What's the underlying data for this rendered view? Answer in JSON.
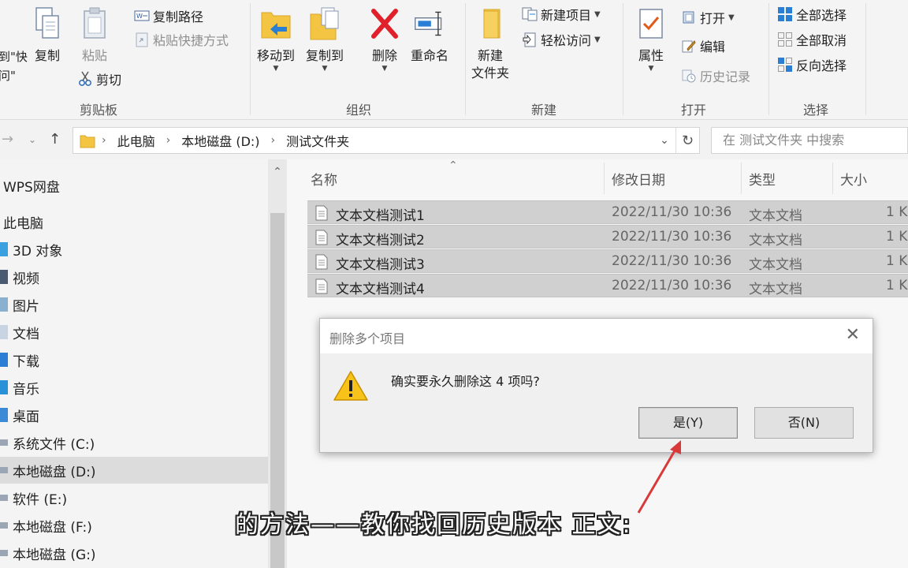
{
  "ribbon": {
    "clipboard": {
      "partial_label": "到\"快\n问\"",
      "copy": "复制",
      "paste": "粘贴",
      "copy_path": "复制路径",
      "paste_shortcut": "粘贴快捷方式",
      "cut": "剪切",
      "group": "剪贴板"
    },
    "organize": {
      "move_to": "移动到",
      "copy_to": "复制到",
      "delete": "删除",
      "rename": "重命名",
      "group": "组织"
    },
    "new": {
      "new_folder": "新建\n文件夹",
      "new_item": "新建项目",
      "easy_access": "轻松访问",
      "group": "新建"
    },
    "open": {
      "properties": "属性",
      "open": "打开",
      "edit": "编辑",
      "history": "历史记录",
      "group": "打开"
    },
    "select": {
      "select_all": "全部选择",
      "select_none": "全部取消",
      "invert": "反向选择",
      "group": "选择"
    }
  },
  "address": {
    "crumbs": [
      "此电脑",
      "本地磁盘 (D:)",
      "测试文件夹"
    ],
    "search_placeholder": "在 测试文件夹 中搜索"
  },
  "sidebar": {
    "items": [
      "WPS网盘",
      "此电脑",
      "3D 对象",
      "视频",
      "图片",
      "文档",
      "下载",
      "音乐",
      "桌面",
      "系统文件 (C:)",
      "本地磁盘 (D:)",
      "软件 (E:)",
      "本地磁盘 (F:)",
      "本地磁盘 (G:)"
    ]
  },
  "filelist": {
    "headers": [
      "名称",
      "修改日期",
      "类型",
      "大小"
    ],
    "rows": [
      {
        "name": "文本文档测试1",
        "date": "2022/11/30 10:36",
        "type": "文本文档",
        "size": "1 K"
      },
      {
        "name": "文本文档测试2",
        "date": "2022/11/30 10:36",
        "type": "文本文档",
        "size": "1 K"
      },
      {
        "name": "文本文档测试3",
        "date": "2022/11/30 10:36",
        "type": "文本文档",
        "size": "1 K"
      },
      {
        "name": "文本文档测试4",
        "date": "2022/11/30 10:36",
        "type": "文本文档",
        "size": "1 K"
      }
    ]
  },
  "dialog": {
    "title": "删除多个项目",
    "message": "确实要永久删除这 4 项吗?",
    "yes": "是(Y)",
    "no": "否(N)"
  },
  "subtitle": "的方法——教你找回历史版本  正文:",
  "colors": {
    "folder": "#f4c542",
    "accent_blue": "#2a7fd4",
    "delete_red": "#e0202a",
    "arrow_red": "#d83a3a"
  }
}
